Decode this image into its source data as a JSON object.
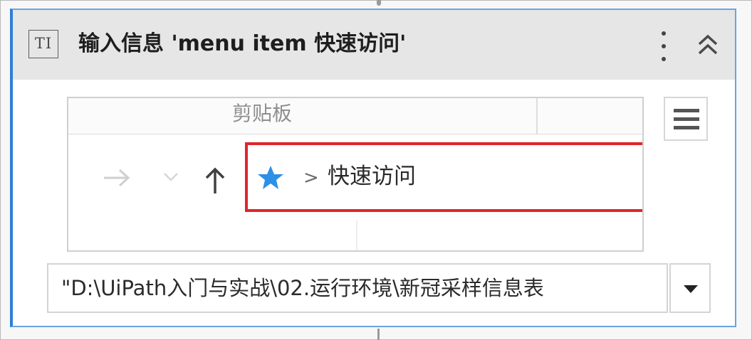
{
  "activity": {
    "type_icon_label": "TI",
    "title": "输入信息 'menu item  快速访问'",
    "icons": {
      "type": "text-input-icon",
      "more": "kebab-menu-icon",
      "collapse": "double-chevron-up-icon",
      "options": "hamburger-menu-icon",
      "dropdown": "dropdown-arrow-icon"
    }
  },
  "preview": {
    "ribbon_label": "剪贴板",
    "nav": {
      "forward": "forward-arrow-icon",
      "recent": "chevron-down-icon",
      "up": "up-arrow-icon"
    },
    "address_separator": ">",
    "address_text": "快速访问"
  },
  "selector": {
    "value": "\"D:\\UiPath入门与实战\\02.运行环境\\新冠采样信息表"
  },
  "colors": {
    "accent": "#2d7fd6",
    "highlight": "#e0252b",
    "star": "#2e8fe6",
    "header_bg": "#e6e6e6"
  }
}
